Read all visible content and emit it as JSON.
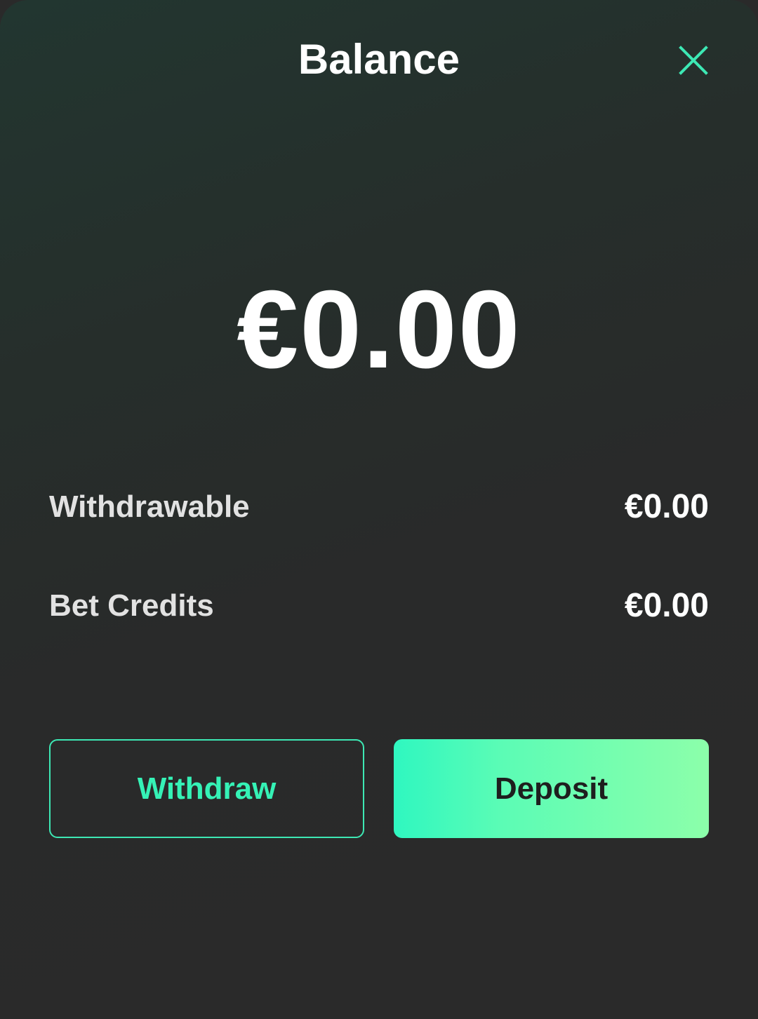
{
  "header": {
    "title": "Balance",
    "close_icon": "close-icon"
  },
  "balance": {
    "total": "€0.00"
  },
  "details": [
    {
      "label": "Withdrawable",
      "value": "€0.00"
    },
    {
      "label": "Bet Credits",
      "value": "€0.00"
    }
  ],
  "actions": {
    "withdraw_label": "Withdraw",
    "deposit_label": "Deposit"
  },
  "colors": {
    "accent": "#35f2b6",
    "deposit_gradient_start": "#2ff7c0",
    "deposit_gradient_end": "#8cffaa",
    "background": "#2a2a2a"
  }
}
